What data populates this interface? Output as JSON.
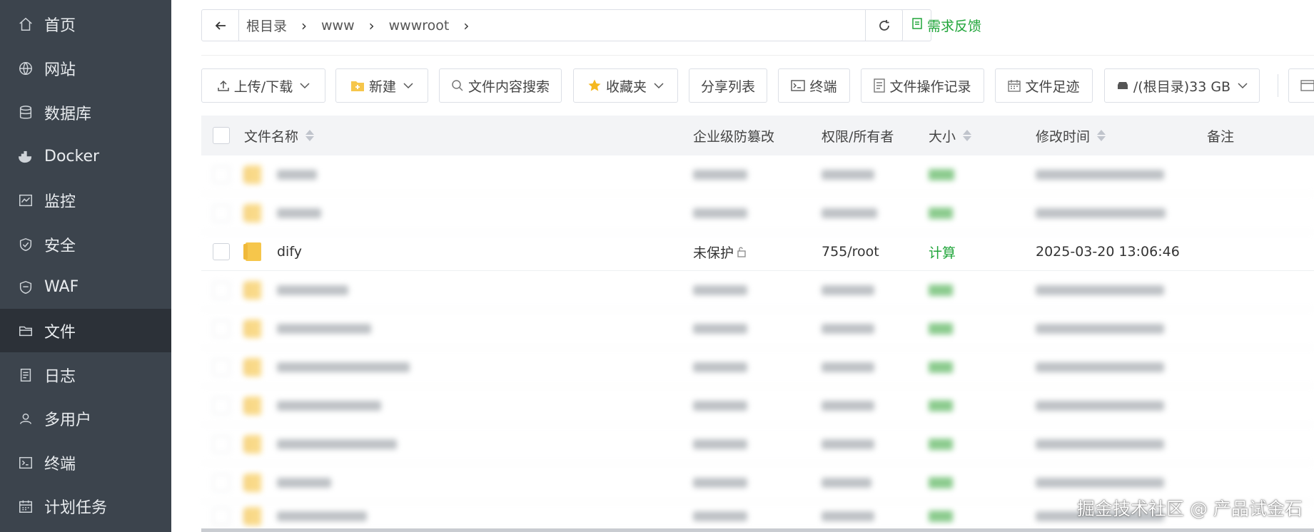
{
  "sidebar": {
    "items": [
      {
        "label": "首页",
        "icon": "home-icon"
      },
      {
        "label": "网站",
        "icon": "globe-icon"
      },
      {
        "label": "数据库",
        "icon": "database-icon"
      },
      {
        "label": "Docker",
        "icon": "docker-icon"
      },
      {
        "label": "监控",
        "icon": "monitor-icon"
      },
      {
        "label": "安全",
        "icon": "shield-icon"
      },
      {
        "label": "WAF",
        "icon": "waf-shield-icon"
      },
      {
        "label": "文件",
        "icon": "folder-icon",
        "active": true
      },
      {
        "label": "日志",
        "icon": "log-icon"
      },
      {
        "label": "多用户",
        "icon": "users-icon"
      },
      {
        "label": "终端",
        "icon": "terminal-icon"
      },
      {
        "label": "计划任务",
        "icon": "calendar-icon"
      }
    ]
  },
  "path": {
    "crumbs": [
      "根目录",
      "www",
      "wwwroot"
    ]
  },
  "feedback_label": "需求反馈",
  "toolbar": {
    "upload": "上传/下载",
    "new": "新建",
    "search": "文件内容搜索",
    "favorites": "收藏夹",
    "share_list": "分享列表",
    "terminal": "终端",
    "op_log": "文件操作记录",
    "footprint": "文件足迹",
    "disk": "/(根目录)33 GB"
  },
  "table": {
    "headers": {
      "name": "文件名称",
      "tamper": "企业级防篡改",
      "perm": "权限/所有者",
      "size": "大小",
      "mtime": "修改时间",
      "note": "备注"
    },
    "visible_row": {
      "name": "dify",
      "tamper": "未保护",
      "perm": "755/root",
      "size": "计算",
      "mtime": "2025-03-20 13:06:46"
    }
  },
  "watermark": "掘金技术社区 @ 产品试金石",
  "colors": {
    "sidebar_bg": "#3c444d",
    "sidebar_active": "#2c3138",
    "accent_green": "#20a53a",
    "folder_yellow": "#f6c64b"
  }
}
